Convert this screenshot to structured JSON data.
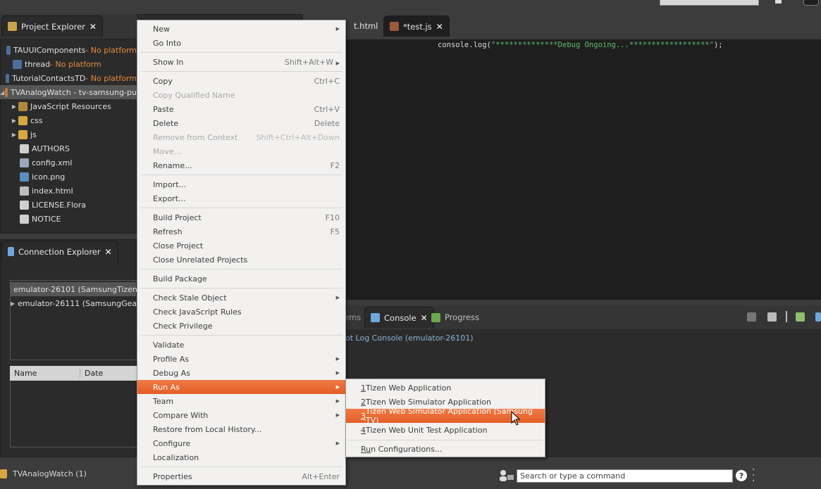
{
  "project_explorer": {
    "tab_label": "Project Explorer",
    "items": [
      {
        "name": "TAUUIComponents",
        "suffix": " - No platform"
      },
      {
        "name": "thread",
        "suffix": " - No platform"
      },
      {
        "name": "TutorialContactsTD",
        "suffix": " - No platform"
      },
      {
        "name": "TVAnalogWatch - tv-samsung-pu",
        "suffix": ""
      },
      {
        "name": "JavaScript Resources",
        "suffix": ""
      },
      {
        "name": "css",
        "suffix": ""
      },
      {
        "name": "js",
        "suffix": ""
      },
      {
        "name": "AUTHORS",
        "suffix": ""
      },
      {
        "name": "config.xml",
        "suffix": ""
      },
      {
        "name": "icon.png",
        "suffix": ""
      },
      {
        "name": "index.html",
        "suffix": ""
      },
      {
        "name": "LICENSE.Flora",
        "suffix": ""
      },
      {
        "name": "NOTICE",
        "suffix": ""
      }
    ]
  },
  "connection_explorer": {
    "tab_label": "Connection Explorer",
    "devices": [
      {
        "label": "emulator-26101 (SamsungTizen"
      },
      {
        "label": "emulator-26111 (SamsungGea"
      }
    ],
    "columns": [
      "Name",
      "Date"
    ]
  },
  "editor": {
    "tabs": [
      {
        "label": "t.html"
      },
      {
        "label": "*test.js"
      }
    ],
    "code_prefix": "console.log(",
    "code_string": "\"**************Debug Ongoing...******************\"",
    "code_suffix": ");"
  },
  "console": {
    "tabs": [
      {
        "label": "ems"
      },
      {
        "label": "Console"
      },
      {
        "label": "Progress"
      }
    ],
    "line": "ot Log Console (emulator-26101)"
  },
  "context_menu": {
    "items": [
      {
        "label": "New",
        "shortcut": "",
        "submenu": true,
        "disabled": false
      },
      {
        "label": "Go Into",
        "shortcut": "",
        "submenu": false,
        "disabled": false
      },
      {
        "label": "Show In",
        "shortcut": "Shift+Alt+W",
        "submenu": true,
        "disabled": false
      },
      {
        "label": "Copy",
        "shortcut": "Ctrl+C",
        "submenu": false,
        "disabled": false
      },
      {
        "label": "Copy Qualified Name",
        "shortcut": "",
        "submenu": false,
        "disabled": true
      },
      {
        "label": "Paste",
        "shortcut": "Ctrl+V",
        "submenu": false,
        "disabled": false
      },
      {
        "label": "Delete",
        "shortcut": "Delete",
        "submenu": false,
        "disabled": false
      },
      {
        "label": "Remove from Context",
        "shortcut": "Shift+Ctrl+Alt+Down",
        "submenu": false,
        "disabled": true
      },
      {
        "label": "Move...",
        "shortcut": "",
        "submenu": false,
        "disabled": true
      },
      {
        "label": "Rename...",
        "shortcut": "F2",
        "submenu": false,
        "disabled": false
      },
      {
        "label": "Import...",
        "shortcut": "",
        "submenu": false,
        "disabled": false
      },
      {
        "label": "Export...",
        "shortcut": "",
        "submenu": false,
        "disabled": false
      },
      {
        "label": "Build Project",
        "shortcut": "F10",
        "submenu": false,
        "disabled": false
      },
      {
        "label": "Refresh",
        "shortcut": "F5",
        "submenu": false,
        "disabled": false
      },
      {
        "label": "Close Project",
        "shortcut": "",
        "submenu": false,
        "disabled": false
      },
      {
        "label": "Close Unrelated Projects",
        "shortcut": "",
        "submenu": false,
        "disabled": false
      },
      {
        "label": "Build Package",
        "shortcut": "",
        "submenu": false,
        "disabled": false
      },
      {
        "label": "Check Stale Object",
        "shortcut": "",
        "submenu": true,
        "disabled": false
      },
      {
        "label": "Check JavaScript Rules",
        "shortcut": "",
        "submenu": false,
        "disabled": false
      },
      {
        "label": "Check Privilege",
        "shortcut": "",
        "submenu": false,
        "disabled": false
      },
      {
        "label": "Validate",
        "shortcut": "",
        "submenu": false,
        "disabled": false
      },
      {
        "label": "Profile As",
        "shortcut": "",
        "submenu": true,
        "disabled": false
      },
      {
        "label": "Debug As",
        "shortcut": "",
        "submenu": true,
        "disabled": false
      },
      {
        "label": "Run As",
        "shortcut": "",
        "submenu": true,
        "disabled": false,
        "highlighted": true
      },
      {
        "label": "Team",
        "shortcut": "",
        "submenu": true,
        "disabled": false
      },
      {
        "label": "Compare With",
        "shortcut": "",
        "submenu": true,
        "disabled": false
      },
      {
        "label": "Restore from Local History...",
        "shortcut": "",
        "submenu": false,
        "disabled": false
      },
      {
        "label": "Configure",
        "shortcut": "",
        "submenu": true,
        "disabled": false
      },
      {
        "label": "Localization",
        "shortcut": "",
        "submenu": false,
        "disabled": false
      },
      {
        "label": "Properties",
        "shortcut": "Alt+Enter",
        "submenu": false,
        "disabled": false
      }
    ]
  },
  "run_as_submenu": {
    "items": [
      {
        "mnemonic": "1",
        "label": " Tizen Web Application"
      },
      {
        "mnemonic": "2",
        "label": " Tizen Web Simulator Application"
      },
      {
        "mnemonic": "3",
        "label": " Tizen Web Simulator Application (Samsung TV)",
        "highlighted": true
      },
      {
        "mnemonic": "4",
        "label": " Tizen Web Unit Test Application"
      },
      {
        "mnemonic": "Ru",
        "label": "n Configurations..."
      }
    ]
  },
  "status_bar": {
    "selection": "TVAnalogWatch (1)",
    "search_placeholder": "Search or type a command"
  },
  "colors": {
    "accent": "#e45d25",
    "editor_bg": "#1e1e1e",
    "panel_bg": "#2b2b2b",
    "menu_bg": "#f2f1f0",
    "no_platform": "#e58b3b",
    "code_string": "#5fbf6f"
  }
}
